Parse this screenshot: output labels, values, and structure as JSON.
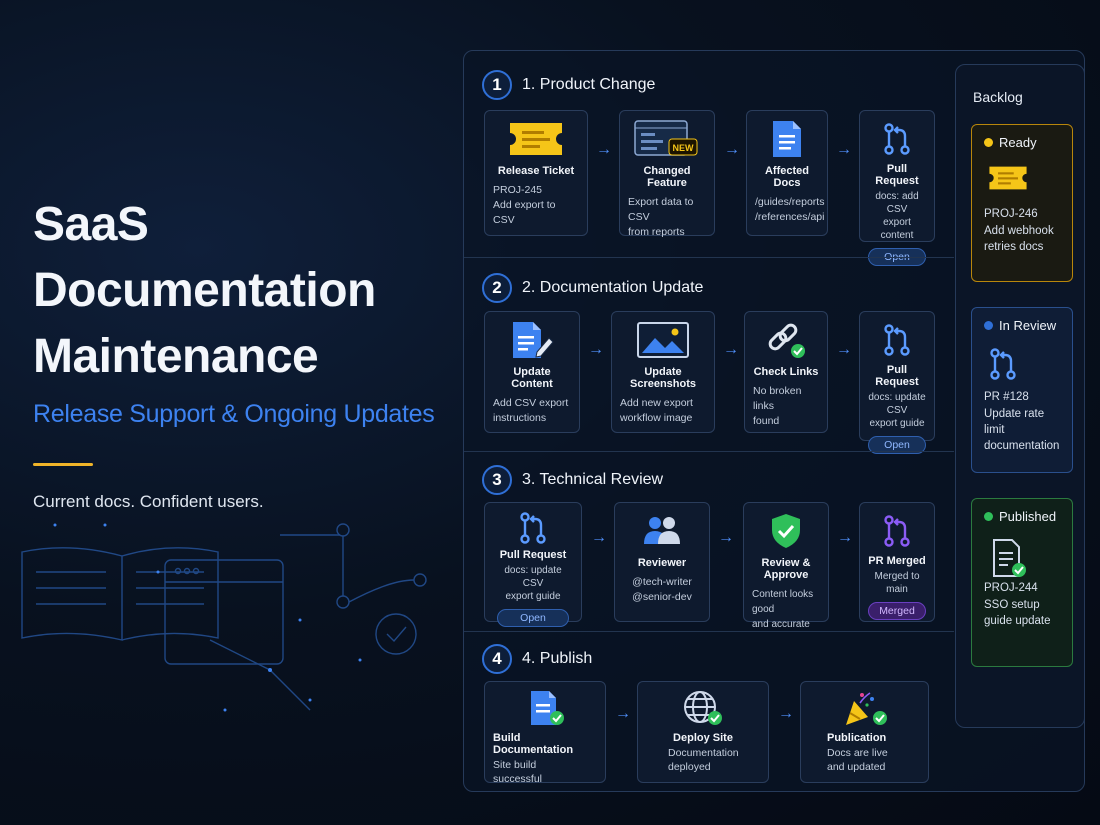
{
  "hero": {
    "title_line1": "SaaS Documentation",
    "title_line2": "Maintenance",
    "subtitle": "Release Support & Ongoing Updates",
    "tagline": "Current docs. Confident users."
  },
  "colors": {
    "accent_blue": "#3d82f0",
    "accent_yellow": "#f0b429",
    "ready": "#f5c518",
    "review": "#2f6fd6",
    "published": "#2fbf5a",
    "merged": "#7c4dff"
  },
  "stages": [
    {
      "num": "1",
      "title": "1. Product Change",
      "cards": [
        {
          "icon": "ticket-icon",
          "title": "Release Ticket",
          "line1": "PROJ-245",
          "line2": "Add export to CSV"
        },
        {
          "icon": "new-feature-window-icon",
          "badge": "NEW",
          "title": "Changed Feature",
          "line1": "Export data to CSV",
          "line2": "from reports"
        },
        {
          "icon": "document-icon",
          "title": "Affected Docs",
          "line1": "/guides/reports",
          "line2": "/references/api"
        },
        {
          "icon": "pull-request-icon",
          "title": "Pull Request",
          "line1": "docs: add CSV",
          "line2": "export content",
          "pill": "Open"
        }
      ]
    },
    {
      "num": "2",
      "title": "2. Documentation Update",
      "cards": [
        {
          "icon": "edit-document-icon",
          "title": "Update Content",
          "line1": "Add CSV export",
          "line2": "instructions"
        },
        {
          "icon": "image-icon",
          "title": "Update Screenshots",
          "line1": "Add new export",
          "line2": "workflow image"
        },
        {
          "icon": "link-check-icon",
          "title": "Check Links",
          "line1": "No broken links",
          "line2": "found"
        },
        {
          "icon": "pull-request-icon",
          "title": "Pull Request",
          "line1": "docs: update CSV",
          "line2": "export guide",
          "pill": "Open"
        }
      ]
    },
    {
      "num": "3",
      "title": "3. Technical Review",
      "cards": [
        {
          "icon": "pull-request-icon",
          "title": "Pull Request",
          "line1": "docs: update CSV",
          "line2": "export guide",
          "pill": "Open"
        },
        {
          "icon": "reviewers-icon",
          "title": "Reviewer",
          "line1": "@tech-writer",
          "line2": "@senior-dev"
        },
        {
          "icon": "shield-check-icon",
          "title": "Review & Approve",
          "line1": "Content looks good",
          "line2": "and accurate"
        },
        {
          "icon": "merged-icon",
          "title": "PR Merged",
          "line1": "Merged to main",
          "line2": "",
          "pill": "Merged"
        }
      ]
    },
    {
      "num": "4",
      "title": "4. Publish",
      "cards": [
        {
          "icon": "document-check-icon",
          "title": "Build Documentation",
          "line1": "Site build",
          "line2": "successful"
        },
        {
          "icon": "globe-check-icon",
          "title": "Deploy Site",
          "line1": "Documentation",
          "line2": "deployed"
        },
        {
          "icon": "celebration-icon",
          "title": "Publication",
          "line1": "Docs are live",
          "line2": "and updated"
        }
      ]
    }
  ],
  "backlog": {
    "title": "Backlog",
    "items": [
      {
        "status": "Ready",
        "icon": "ticket-icon",
        "id": "PROJ-246",
        "desc_line1": "Add webhook",
        "desc_line2": "retries docs"
      },
      {
        "status": "In Review",
        "icon": "pull-request-icon",
        "id": "PR #128",
        "desc_line1": "Update rate limit",
        "desc_line2": "documentation"
      },
      {
        "status": "Published",
        "icon": "document-check-icon",
        "id": "PROJ-244",
        "desc_line1": "SSO setup",
        "desc_line2": "guide update"
      }
    ]
  }
}
